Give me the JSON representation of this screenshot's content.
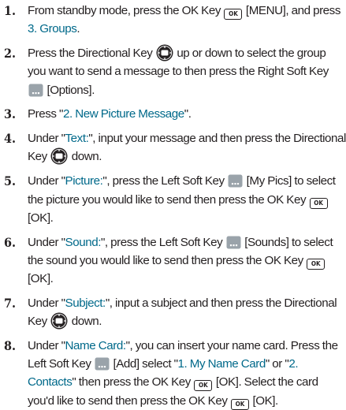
{
  "steps": [
    {
      "num": "1.",
      "parts": [
        {
          "t": "text",
          "v": "From standby mode, press the OK Key "
        },
        {
          "t": "ok"
        },
        {
          "t": "text",
          "v": " [MENU], and press "
        },
        {
          "t": "hl",
          "v": "3. Groups"
        },
        {
          "t": "text",
          "v": "."
        }
      ]
    },
    {
      "num": "2.",
      "parts": [
        {
          "t": "text",
          "v": "Press the Directional Key "
        },
        {
          "t": "dir"
        },
        {
          "t": "text",
          "v": " up or down to select the group you want to send a message to then press the Right Soft Key "
        },
        {
          "t": "soft"
        },
        {
          "t": "text",
          "v": " [Options]."
        }
      ]
    },
    {
      "num": "3.",
      "parts": [
        {
          "t": "text",
          "v": "Press \""
        },
        {
          "t": "hl",
          "v": "2. New Picture Message"
        },
        {
          "t": "text",
          "v": "\"."
        }
      ]
    },
    {
      "num": "4.",
      "parts": [
        {
          "t": "text",
          "v": "Under \""
        },
        {
          "t": "hl",
          "v": "Text:"
        },
        {
          "t": "text",
          "v": "\", input your message and then press the Directional Key "
        },
        {
          "t": "dir"
        },
        {
          "t": "text",
          "v": " down."
        }
      ]
    },
    {
      "num": "5.",
      "parts": [
        {
          "t": "text",
          "v": "Under \""
        },
        {
          "t": "hl",
          "v": "Picture:"
        },
        {
          "t": "text",
          "v": "\", press the Left Soft Key "
        },
        {
          "t": "soft"
        },
        {
          "t": "text",
          "v": " [My Pics] to select the picture you would like to send then press the OK Key "
        },
        {
          "t": "ok"
        },
        {
          "t": "text",
          "v": " [OK]."
        }
      ]
    },
    {
      "num": "6.",
      "parts": [
        {
          "t": "text",
          "v": "Under \""
        },
        {
          "t": "hl",
          "v": "Sound:"
        },
        {
          "t": "text",
          "v": "\", press the Left Soft Key "
        },
        {
          "t": "soft"
        },
        {
          "t": "text",
          "v": " [Sounds] to select the sound you would like to send then press the OK Key "
        },
        {
          "t": "ok"
        },
        {
          "t": "text",
          "v": " [OK]."
        }
      ]
    },
    {
      "num": "7.",
      "parts": [
        {
          "t": "text",
          "v": "Under \""
        },
        {
          "t": "hl",
          "v": "Subject:"
        },
        {
          "t": "text",
          "v": "\", input a subject and then press the Directional Key "
        },
        {
          "t": "dir"
        },
        {
          "t": "text",
          "v": " down."
        }
      ]
    },
    {
      "num": "8.",
      "parts": [
        {
          "t": "text",
          "v": "Under \""
        },
        {
          "t": "hl",
          "v": "Name Card:"
        },
        {
          "t": "text",
          "v": "\", you can insert your name card. Press the Left Soft Key "
        },
        {
          "t": "soft"
        },
        {
          "t": "text",
          "v": " [Add] select \""
        },
        {
          "t": "hl",
          "v": "1. My Name Card"
        },
        {
          "t": "text",
          "v": "\" or \""
        },
        {
          "t": "hl",
          "v": "2. Contacts"
        },
        {
          "t": "text",
          "v": "\" then press the OK Key "
        },
        {
          "t": "ok"
        },
        {
          "t": "text",
          "v": " [OK]. Select the card you'd like to send then press the OK Key "
        },
        {
          "t": "ok"
        },
        {
          "t": "text",
          "v": " [OK]."
        }
      ]
    }
  ],
  "icons": {
    "ok_key": {
      "name": "ok-key-icon",
      "label": "OK"
    },
    "directional_key": {
      "name": "directional-key-icon"
    },
    "soft_key": {
      "name": "soft-key-icon"
    }
  },
  "colors": {
    "text": "#231f20",
    "highlight": "#00698a",
    "soft_key_fill": "#9aa3aa"
  }
}
